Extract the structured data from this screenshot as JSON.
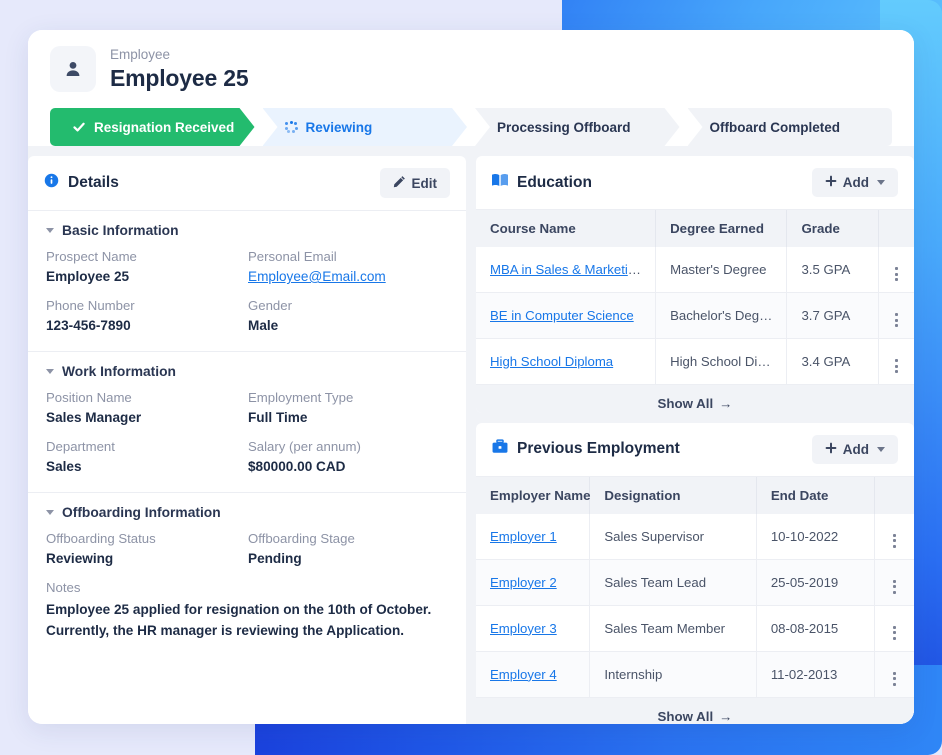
{
  "colors": {
    "accent_green": "#23bb6e",
    "accent_blue": "#1877e8",
    "text_dark": "#1d2b45",
    "muted": "#8d93a6",
    "panel_bg": "#f1f3f7"
  },
  "header": {
    "eyebrow": "Employee",
    "title": "Employee 25",
    "avatar_icon": "person-icon"
  },
  "steps": [
    {
      "label": "Resignation Received",
      "state": "completed",
      "icon": "check-icon"
    },
    {
      "label": "Reviewing",
      "state": "current",
      "icon": "spinner-icon"
    },
    {
      "label": "Processing Offboard",
      "state": "pending",
      "icon": ""
    },
    {
      "label": "Offboard Completed",
      "state": "pending",
      "icon": ""
    }
  ],
  "details": {
    "icon": "info-circle-icon",
    "title": "Details",
    "edit_label": "Edit",
    "edit_icon": "pencil-icon",
    "sections": [
      {
        "title": "Basic Information",
        "fields": [
          {
            "label": "Prospect Name",
            "value": "Employee 25",
            "type": "text"
          },
          {
            "label": "Personal Email",
            "value": "Employee@Email.com",
            "type": "link"
          },
          {
            "label": "Phone Number",
            "value": "123-456-7890",
            "type": "text"
          },
          {
            "label": "Gender",
            "value": "Male",
            "type": "text"
          }
        ]
      },
      {
        "title": "Work Information",
        "fields": [
          {
            "label": "Position Name",
            "value": "Sales Manager",
            "type": "text"
          },
          {
            "label": "Employment Type",
            "value": "Full Time",
            "type": "text"
          },
          {
            "label": "Department",
            "value": "Sales",
            "type": "text"
          },
          {
            "label": "Salary (per annum)",
            "value": "$80000.00 CAD",
            "type": "text"
          }
        ]
      },
      {
        "title": "Offboarding Information",
        "fields": [
          {
            "label": "Offboarding Status",
            "value": "Reviewing",
            "type": "text"
          },
          {
            "label": "Offboarding Stage",
            "value": "Pending",
            "type": "text"
          },
          {
            "label": "Notes",
            "value": "Employee 25  applied for resignation on the 10th of October. Currently, the HR manager is reviewing the Application.",
            "type": "note"
          }
        ]
      }
    ]
  },
  "education": {
    "icon": "book-icon",
    "title": "Education",
    "add_label": "Add",
    "add_icon": "plus-icon",
    "columns": [
      "Course Name",
      "Degree Earned",
      "Grade",
      ""
    ],
    "rows": [
      {
        "course": "MBA in Sales & Marketing",
        "degree": "Master's Degree",
        "grade": "3.5 GPA"
      },
      {
        "course": "BE in Computer Science",
        "degree": "Bachelor's Degree",
        "grade": "3.7 GPA"
      },
      {
        "course": "High School Diploma",
        "degree": "High School Diploma",
        "grade": "3.4 GPA"
      }
    ],
    "show_all_label": "Show All"
  },
  "previous_employment": {
    "icon": "briefcase-icon",
    "title": "Previous Employment",
    "add_label": "Add",
    "add_icon": "plus-icon",
    "columns": [
      "Employer Name",
      "Designation",
      "End Date",
      ""
    ],
    "rows": [
      {
        "employer": "Employer 1",
        "designation": "Sales Supervisor",
        "end_date": "10-10-2022"
      },
      {
        "employer": "Employer 2",
        "designation": "Sales Team Lead",
        "end_date": "25-05-2019"
      },
      {
        "employer": "Employer 3",
        "designation": "Sales Team Member",
        "end_date": "08-08-2015"
      },
      {
        "employer": "Employer 4",
        "designation": "Internship",
        "end_date": "11-02-2013"
      }
    ],
    "show_all_label": "Show All"
  }
}
